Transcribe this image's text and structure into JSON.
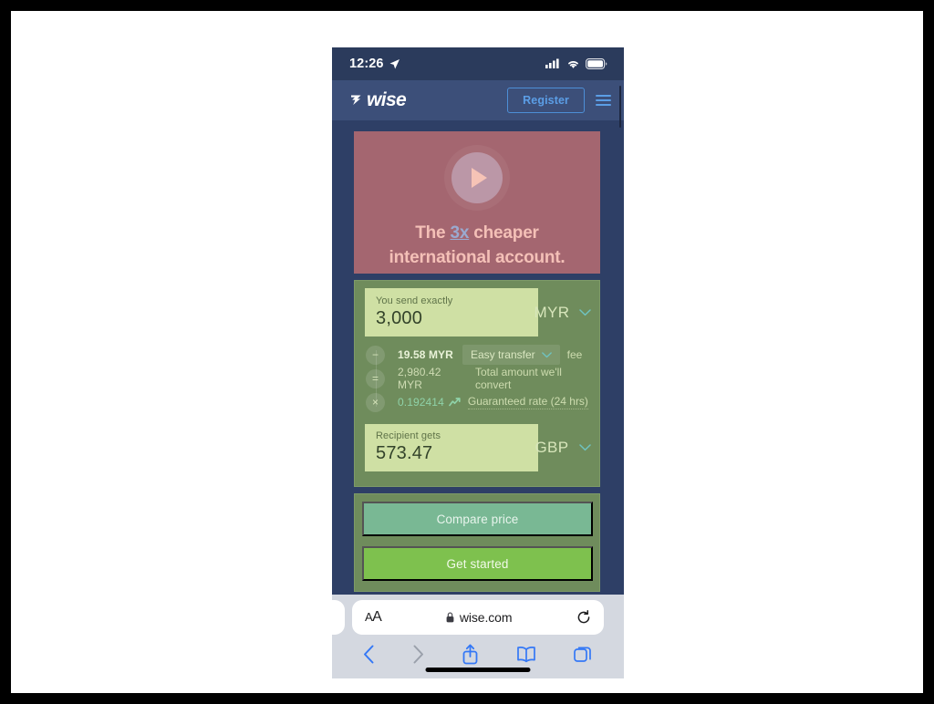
{
  "status_bar": {
    "time": "12:26",
    "location_icon": "location-arrow-icon",
    "signal_icon": "cellular-signal-icon",
    "wifi_icon": "wifi-icon",
    "battery_icon": "battery-icon"
  },
  "site_header": {
    "logo_text": "wise",
    "logo_mark": "wise-flag-icon",
    "register_label": "Register",
    "menu_icon": "hamburger-menu-icon"
  },
  "hero": {
    "play_icon": "play-button-icon",
    "line1_before": "The ",
    "line1_highlight": "3x",
    "line1_after": " cheaper",
    "line2": "international account."
  },
  "converter": {
    "send": {
      "label": "You send exactly",
      "value": "3,000",
      "currency": "MYR",
      "chevron_icon": "chevron-down-icon"
    },
    "rows": [
      {
        "operator": "−",
        "operator_name": "minus",
        "amount": "19.58 MYR",
        "pill_label": "Easy transfer",
        "pill_chevron": "chevron-down-icon",
        "text": "fee"
      },
      {
        "operator": "=",
        "operator_name": "equals",
        "amount": "2,980.42 MYR",
        "text": "Total amount we'll convert"
      },
      {
        "operator": "×",
        "operator_name": "multiply",
        "amount": "0.192414",
        "trend_icon": "trend-up-icon",
        "text": "Guaranteed rate (24 hrs)"
      }
    ],
    "receive": {
      "label": "Recipient gets",
      "value": "573.47",
      "currency": "GBP",
      "chevron_icon": "chevron-down-icon"
    }
  },
  "actions": {
    "compare_label": "Compare price",
    "get_started_label": "Get started"
  },
  "safari": {
    "text_size_label": "AA",
    "lock_icon": "lock-icon",
    "url": "wise.com",
    "reload_icon": "reload-icon",
    "back_icon": "back-chevron-icon",
    "forward_icon": "forward-chevron-icon",
    "share_icon": "share-icon",
    "bookmarks_icon": "book-icon",
    "tabs_icon": "tabs-icon"
  }
}
